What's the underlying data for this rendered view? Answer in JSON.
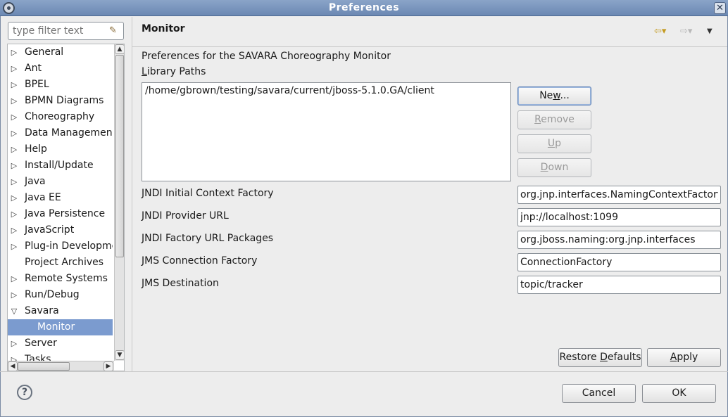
{
  "window": {
    "title": "Preferences"
  },
  "filter": {
    "placeholder": "type filter text"
  },
  "tree": {
    "items": [
      {
        "label": "General",
        "expand": "collapsed"
      },
      {
        "label": "Ant",
        "expand": "collapsed"
      },
      {
        "label": "BPEL",
        "expand": "collapsed"
      },
      {
        "label": "BPMN Diagrams",
        "expand": "collapsed"
      },
      {
        "label": "Choreography",
        "expand": "collapsed"
      },
      {
        "label": "Data Management",
        "expand": "collapsed"
      },
      {
        "label": "Help",
        "expand": "collapsed"
      },
      {
        "label": "Install/Update",
        "expand": "collapsed"
      },
      {
        "label": "Java",
        "expand": "collapsed"
      },
      {
        "label": "Java EE",
        "expand": "collapsed"
      },
      {
        "label": "Java Persistence",
        "expand": "collapsed"
      },
      {
        "label": "JavaScript",
        "expand": "collapsed"
      },
      {
        "label": "Plug-in Developme",
        "expand": "collapsed"
      },
      {
        "label": "Project Archives",
        "expand": "none"
      },
      {
        "label": "Remote Systems",
        "expand": "collapsed"
      },
      {
        "label": "Run/Debug",
        "expand": "collapsed"
      },
      {
        "label": "Savara",
        "expand": "expanded"
      },
      {
        "label": "Monitor",
        "expand": "child",
        "selected": true
      },
      {
        "label": "Server",
        "expand": "collapsed"
      },
      {
        "label": "Tasks",
        "expand": "collapsed"
      }
    ]
  },
  "page": {
    "title": "Monitor",
    "description": "Preferences for the SAVARA Choreography Monitor",
    "library_label_mnemonic": "L",
    "library_label_rest": "ibrary Paths",
    "library_paths": [
      "/home/gbrown/testing/savara/current/jboss-5.1.0.GA/client"
    ],
    "buttons": {
      "new_pre": "Ne",
      "new_mn": "w",
      "new_post": "...",
      "remove_mn": "R",
      "remove_post": "emove",
      "up_mn": "U",
      "up_post": "p",
      "down_mn": "D",
      "down_post": "own"
    },
    "fields": {
      "jndi_context_label": "JNDI Initial Context Factory",
      "jndi_context_value": "org.jnp.interfaces.NamingContextFactory",
      "jndi_url_label": "JNDI Provider URL",
      "jndi_url_value": "jnp://localhost:1099",
      "jndi_pkgs_label": "JNDI Factory URL Packages",
      "jndi_pkgs_value": "org.jboss.naming:org.jnp.interfaces",
      "jms_factory_label": "JMS Connection Factory",
      "jms_factory_value": "ConnectionFactory",
      "jms_dest_label": "JMS Destination",
      "jms_dest_value": "topic/tracker"
    },
    "restore_pre": "Restore ",
    "restore_mn": "D",
    "restore_post": "efaults",
    "apply_mn": "A",
    "apply_post": "pply"
  },
  "dialog": {
    "cancel": "Cancel",
    "ok": "OK",
    "help_glyph": "?"
  },
  "icons": {
    "app": "app-icon",
    "close": "close-icon",
    "back": "back-arrow-icon",
    "forward": "forward-arrow-icon",
    "menu": "view-menu-icon",
    "clear": "clear-filter-icon",
    "help": "help-icon"
  },
  "colors": {
    "titlebar": "#6b88b3",
    "selection": "#7b9bcf",
    "back_arrow": "#c49a1e"
  }
}
